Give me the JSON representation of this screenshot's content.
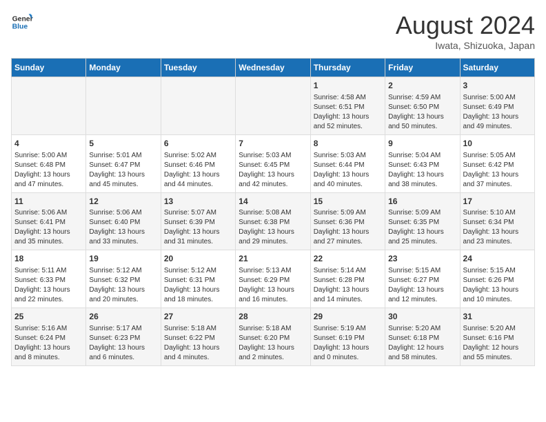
{
  "logo": {
    "line1": "General",
    "line2": "Blue"
  },
  "title": "August 2024",
  "subtitle": "Iwata, Shizuoka, Japan",
  "weekdays": [
    "Sunday",
    "Monday",
    "Tuesday",
    "Wednesday",
    "Thursday",
    "Friday",
    "Saturday"
  ],
  "rows": [
    [
      {
        "day": "",
        "info": ""
      },
      {
        "day": "",
        "info": ""
      },
      {
        "day": "",
        "info": ""
      },
      {
        "day": "",
        "info": ""
      },
      {
        "day": "1",
        "info": "Sunrise: 4:58 AM\nSunset: 6:51 PM\nDaylight: 13 hours\nand 52 minutes."
      },
      {
        "day": "2",
        "info": "Sunrise: 4:59 AM\nSunset: 6:50 PM\nDaylight: 13 hours\nand 50 minutes."
      },
      {
        "day": "3",
        "info": "Sunrise: 5:00 AM\nSunset: 6:49 PM\nDaylight: 13 hours\nand 49 minutes."
      }
    ],
    [
      {
        "day": "4",
        "info": "Sunrise: 5:00 AM\nSunset: 6:48 PM\nDaylight: 13 hours\nand 47 minutes."
      },
      {
        "day": "5",
        "info": "Sunrise: 5:01 AM\nSunset: 6:47 PM\nDaylight: 13 hours\nand 45 minutes."
      },
      {
        "day": "6",
        "info": "Sunrise: 5:02 AM\nSunset: 6:46 PM\nDaylight: 13 hours\nand 44 minutes."
      },
      {
        "day": "7",
        "info": "Sunrise: 5:03 AM\nSunset: 6:45 PM\nDaylight: 13 hours\nand 42 minutes."
      },
      {
        "day": "8",
        "info": "Sunrise: 5:03 AM\nSunset: 6:44 PM\nDaylight: 13 hours\nand 40 minutes."
      },
      {
        "day": "9",
        "info": "Sunrise: 5:04 AM\nSunset: 6:43 PM\nDaylight: 13 hours\nand 38 minutes."
      },
      {
        "day": "10",
        "info": "Sunrise: 5:05 AM\nSunset: 6:42 PM\nDaylight: 13 hours\nand 37 minutes."
      }
    ],
    [
      {
        "day": "11",
        "info": "Sunrise: 5:06 AM\nSunset: 6:41 PM\nDaylight: 13 hours\nand 35 minutes."
      },
      {
        "day": "12",
        "info": "Sunrise: 5:06 AM\nSunset: 6:40 PM\nDaylight: 13 hours\nand 33 minutes."
      },
      {
        "day": "13",
        "info": "Sunrise: 5:07 AM\nSunset: 6:39 PM\nDaylight: 13 hours\nand 31 minutes."
      },
      {
        "day": "14",
        "info": "Sunrise: 5:08 AM\nSunset: 6:38 PM\nDaylight: 13 hours\nand 29 minutes."
      },
      {
        "day": "15",
        "info": "Sunrise: 5:09 AM\nSunset: 6:36 PM\nDaylight: 13 hours\nand 27 minutes."
      },
      {
        "day": "16",
        "info": "Sunrise: 5:09 AM\nSunset: 6:35 PM\nDaylight: 13 hours\nand 25 minutes."
      },
      {
        "day": "17",
        "info": "Sunrise: 5:10 AM\nSunset: 6:34 PM\nDaylight: 13 hours\nand 23 minutes."
      }
    ],
    [
      {
        "day": "18",
        "info": "Sunrise: 5:11 AM\nSunset: 6:33 PM\nDaylight: 13 hours\nand 22 minutes."
      },
      {
        "day": "19",
        "info": "Sunrise: 5:12 AM\nSunset: 6:32 PM\nDaylight: 13 hours\nand 20 minutes."
      },
      {
        "day": "20",
        "info": "Sunrise: 5:12 AM\nSunset: 6:31 PM\nDaylight: 13 hours\nand 18 minutes."
      },
      {
        "day": "21",
        "info": "Sunrise: 5:13 AM\nSunset: 6:29 PM\nDaylight: 13 hours\nand 16 minutes."
      },
      {
        "day": "22",
        "info": "Sunrise: 5:14 AM\nSunset: 6:28 PM\nDaylight: 13 hours\nand 14 minutes."
      },
      {
        "day": "23",
        "info": "Sunrise: 5:15 AM\nSunset: 6:27 PM\nDaylight: 13 hours\nand 12 minutes."
      },
      {
        "day": "24",
        "info": "Sunrise: 5:15 AM\nSunset: 6:26 PM\nDaylight: 13 hours\nand 10 minutes."
      }
    ],
    [
      {
        "day": "25",
        "info": "Sunrise: 5:16 AM\nSunset: 6:24 PM\nDaylight: 13 hours\nand 8 minutes."
      },
      {
        "day": "26",
        "info": "Sunrise: 5:17 AM\nSunset: 6:23 PM\nDaylight: 13 hours\nand 6 minutes."
      },
      {
        "day": "27",
        "info": "Sunrise: 5:18 AM\nSunset: 6:22 PM\nDaylight: 13 hours\nand 4 minutes."
      },
      {
        "day": "28",
        "info": "Sunrise: 5:18 AM\nSunset: 6:20 PM\nDaylight: 13 hours\nand 2 minutes."
      },
      {
        "day": "29",
        "info": "Sunrise: 5:19 AM\nSunset: 6:19 PM\nDaylight: 13 hours\nand 0 minutes."
      },
      {
        "day": "30",
        "info": "Sunrise: 5:20 AM\nSunset: 6:18 PM\nDaylight: 12 hours\nand 58 minutes."
      },
      {
        "day": "31",
        "info": "Sunrise: 5:20 AM\nSunset: 6:16 PM\nDaylight: 12 hours\nand 55 minutes."
      }
    ]
  ]
}
